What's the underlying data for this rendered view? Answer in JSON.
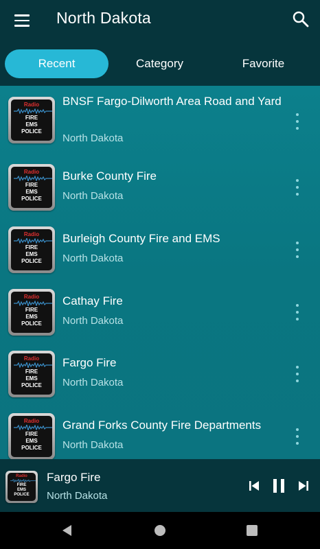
{
  "app": {
    "title": "North Dakota"
  },
  "tabs": [
    {
      "label": "Recent",
      "active": true
    },
    {
      "label": "Category",
      "active": false
    },
    {
      "label": "Favorite",
      "active": false
    }
  ],
  "thumb": {
    "radio": "Radio",
    "line1": "FIRE",
    "line2": "EMS",
    "line3": "POLICE"
  },
  "list": [
    {
      "title": "BNSF Fargo-Dilworth Area Road and Yard",
      "subtitle": "North Dakota"
    },
    {
      "title": "Burke County Fire",
      "subtitle": "North Dakota"
    },
    {
      "title": "Burleigh County Fire and EMS",
      "subtitle": "North Dakota"
    },
    {
      "title": "Cathay Fire",
      "subtitle": "North Dakota"
    },
    {
      "title": "Fargo Fire",
      "subtitle": "North Dakota"
    },
    {
      "title": "Grand Forks County Fire Departments",
      "subtitle": "North Dakota"
    }
  ],
  "player": {
    "title": "Fargo Fire",
    "subtitle": "North Dakota",
    "state": "playing"
  },
  "icons": {
    "menu": "menu-icon",
    "search": "search-icon",
    "more": "more-vertical-icon",
    "previous": "skip-previous-icon",
    "pause": "pause-icon",
    "next": "skip-next-icon",
    "back": "nav-back-icon",
    "home": "nav-home-icon",
    "recents": "nav-recents-icon"
  },
  "colors": {
    "topbar": "#06353c",
    "tab_active": "#27b8d6",
    "list_bg": "#0a7681",
    "thumb_radio": "#e03030",
    "subtitle": "#b8e2e6",
    "wave": "#3a8ec8"
  }
}
